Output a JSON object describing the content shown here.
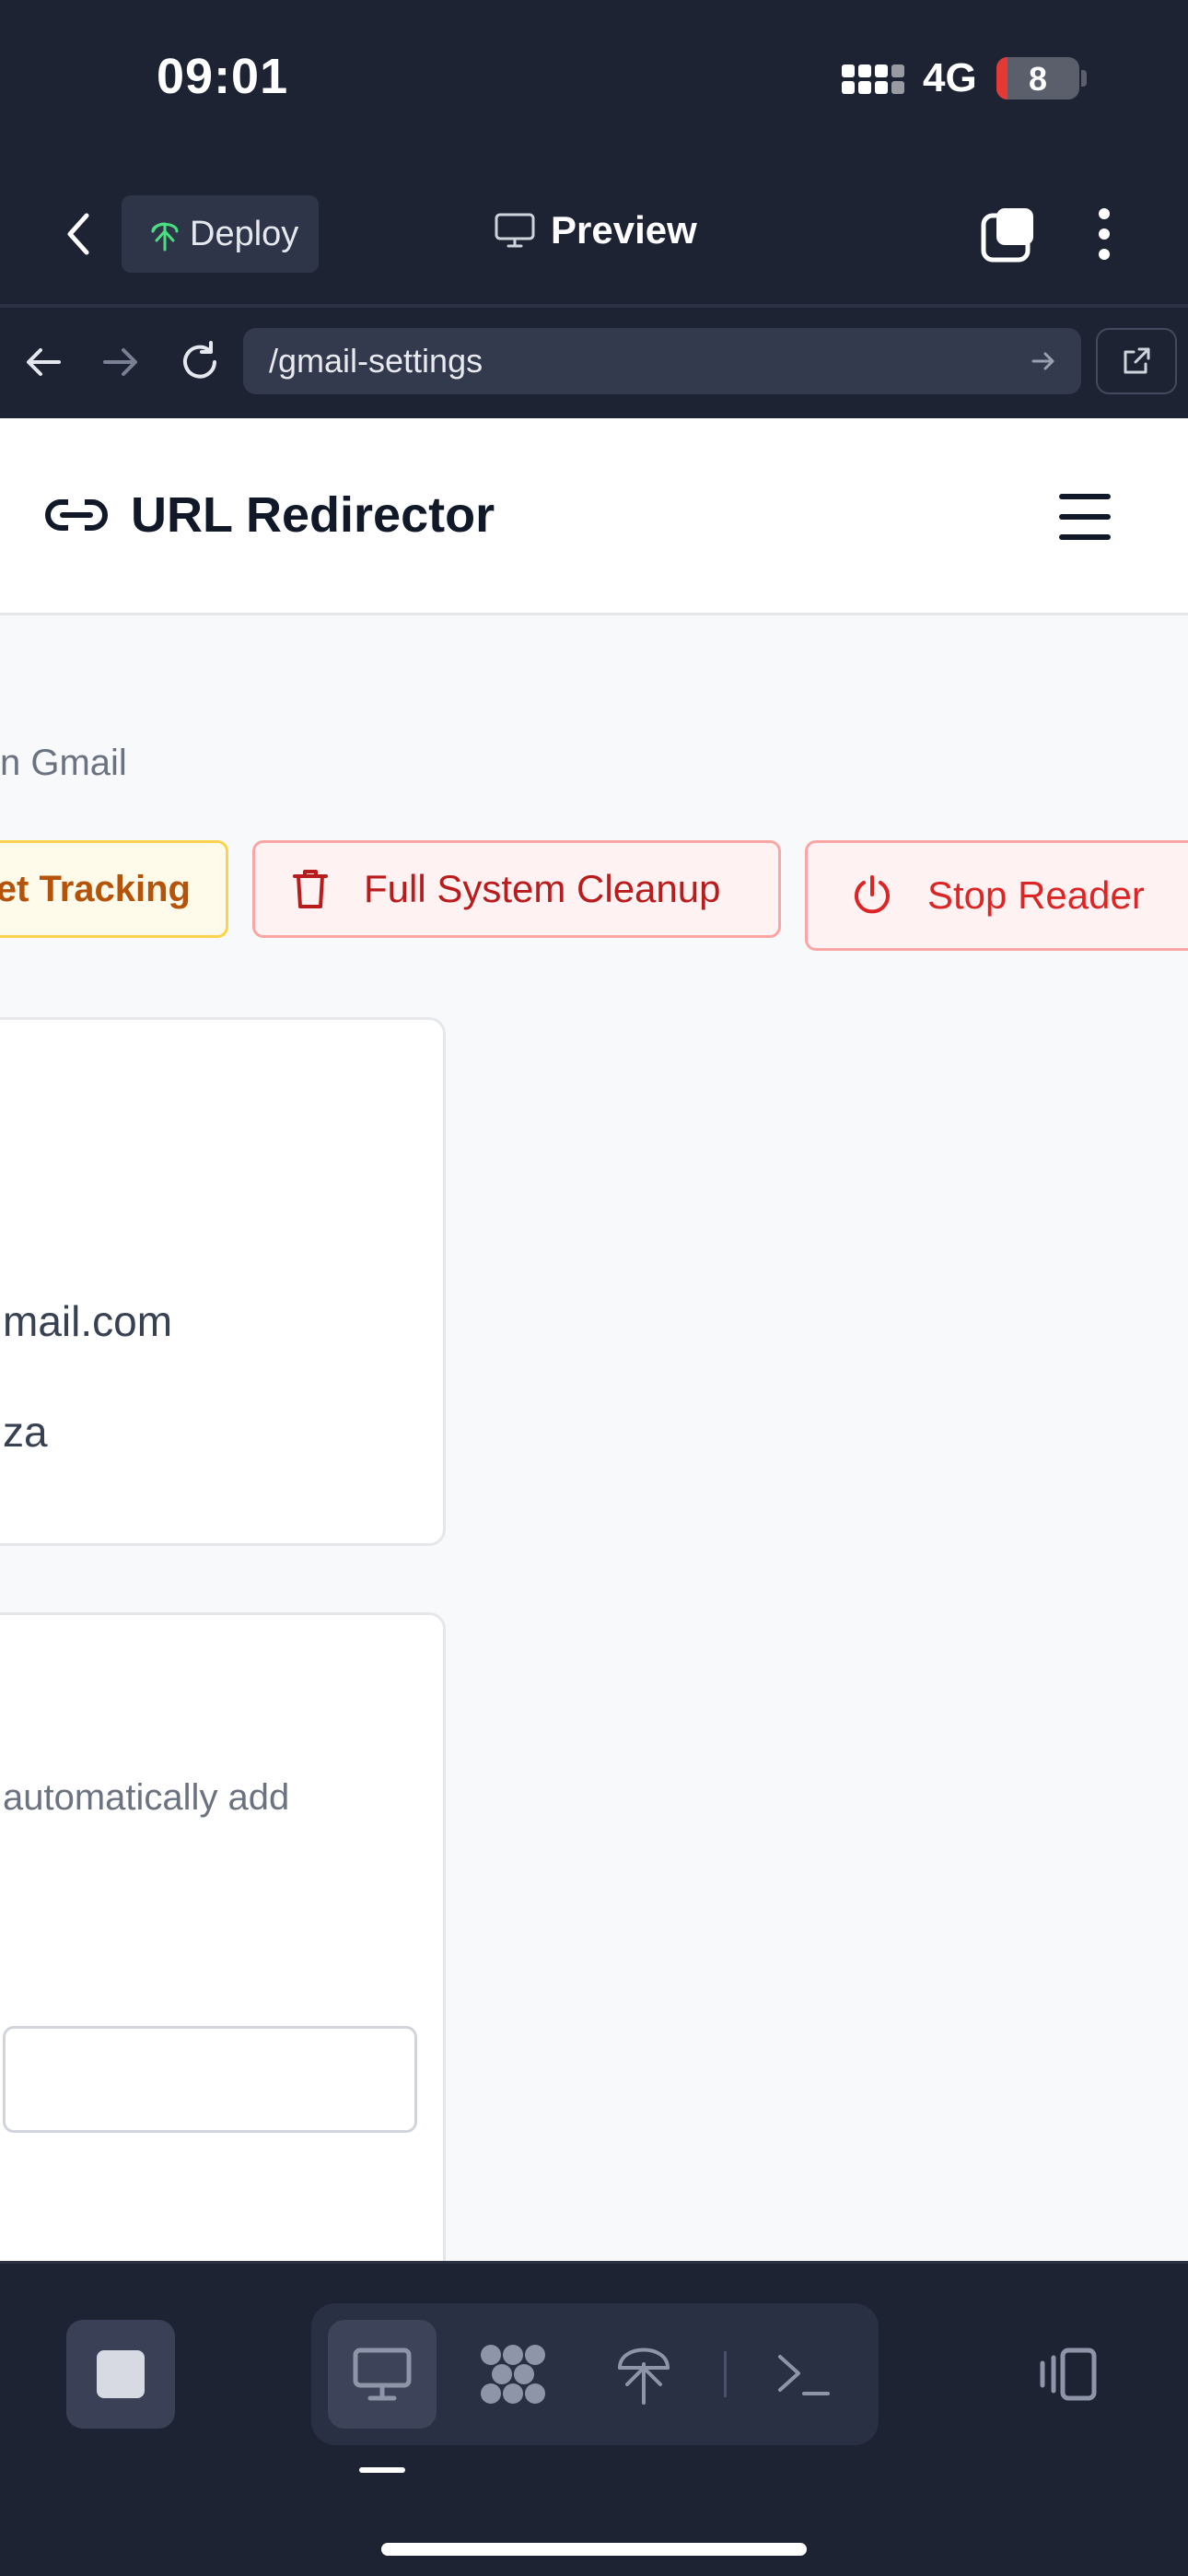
{
  "status_bar": {
    "time": "09:01",
    "network": "4G",
    "battery_level": "8",
    "battery_color": "#e53935"
  },
  "app_bar": {
    "deploy_label": "Deploy",
    "preview_label": "Preview",
    "icons": [
      "back-chevron-icon",
      "deploy-tree-icon",
      "monitor-icon",
      "tabs-icon",
      "more-vertical-icon"
    ]
  },
  "browser_bar": {
    "url": "/gmail-settings",
    "icons": [
      "back-arrow-icon",
      "forward-arrow-icon",
      "reload-icon",
      "go-arrow-icon",
      "external-link-icon"
    ]
  },
  "site": {
    "brand_title": "URL Redirector",
    "subtitle": "n Gmail",
    "actions": {
      "reset_label": "et Tracking",
      "cleanup_label": "Full System Cleanup",
      "stop_label": "Stop Reader"
    },
    "card1": {
      "email_fragment": "mail.com",
      "name_fragment": "za"
    },
    "card2": {
      "description_fragment": "automatically add",
      "input_value": ""
    }
  },
  "bottom_toolbar": {
    "icons": [
      "stop-icon",
      "desktop-icon",
      "extensions-icon",
      "deploy-icon",
      "terminal-icon",
      "layout-toggle-icon"
    ],
    "active": "desktop"
  },
  "colors": {
    "chrome_bg": "#1e2333",
    "accent_red": "#dc2626",
    "accent_amber": "#b45309"
  }
}
